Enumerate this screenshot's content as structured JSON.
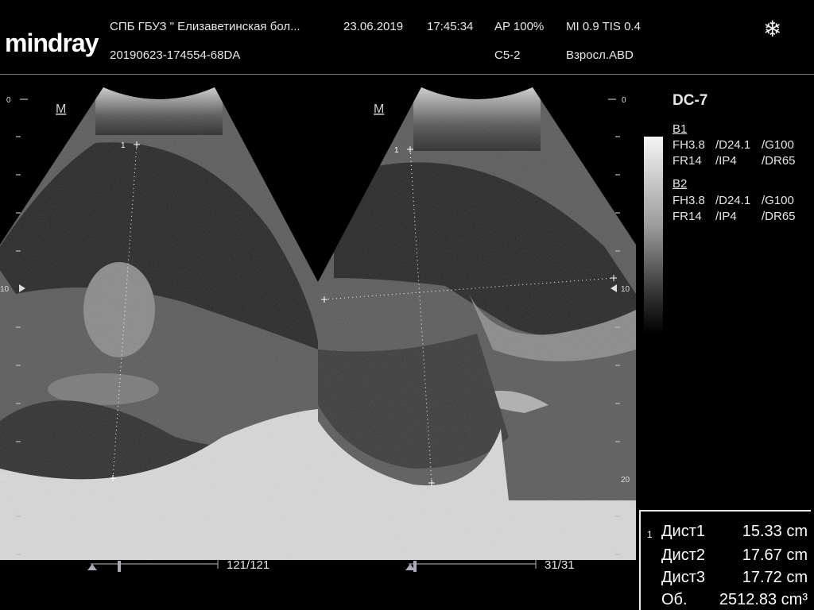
{
  "header": {
    "logo": "mindray",
    "institution": "СПБ  ГБУЗ \" Елизаветинская бол...",
    "date": "23.06.2019",
    "time": "17:45:34",
    "ap": "AP  100%",
    "mi_tis": "MI 0.9 TIS 0.4",
    "exam_id": "20190623-174554-68DA",
    "probe": "C5-2",
    "preset": "Взросл.ABD"
  },
  "icons": {
    "freeze": "snowflake-icon"
  },
  "images": {
    "left": {
      "marker": "M",
      "cursor_label": "1",
      "frame": "121/121"
    },
    "right": {
      "marker": "M",
      "cursor_label": "1",
      "frame": "31/31"
    },
    "depth_ticks": {
      "top": "0",
      "mid": "10",
      "bottom": "20"
    }
  },
  "params": {
    "title": "DC-7",
    "b1": {
      "label": "B1",
      "row1": [
        "FH3.8",
        "/D24.1",
        "/G100"
      ],
      "row2": [
        "FR14",
        "/IP4",
        "/DR65"
      ]
    },
    "b2": {
      "label": "B2",
      "row1": [
        "FH3.8",
        "/D24.1",
        "/G100"
      ],
      "row2": [
        "FR14",
        "/IP4",
        "/DR65"
      ]
    }
  },
  "measurements": {
    "index": "1",
    "rows": [
      {
        "name": "Дист1",
        "value": "15.33 cm"
      },
      {
        "name": "Дист2",
        "value": "17.67 cm"
      },
      {
        "name": "Дист3",
        "value": "17.72 cm"
      },
      {
        "name": "Об.",
        "value": "2512.83 cm³"
      }
    ]
  }
}
